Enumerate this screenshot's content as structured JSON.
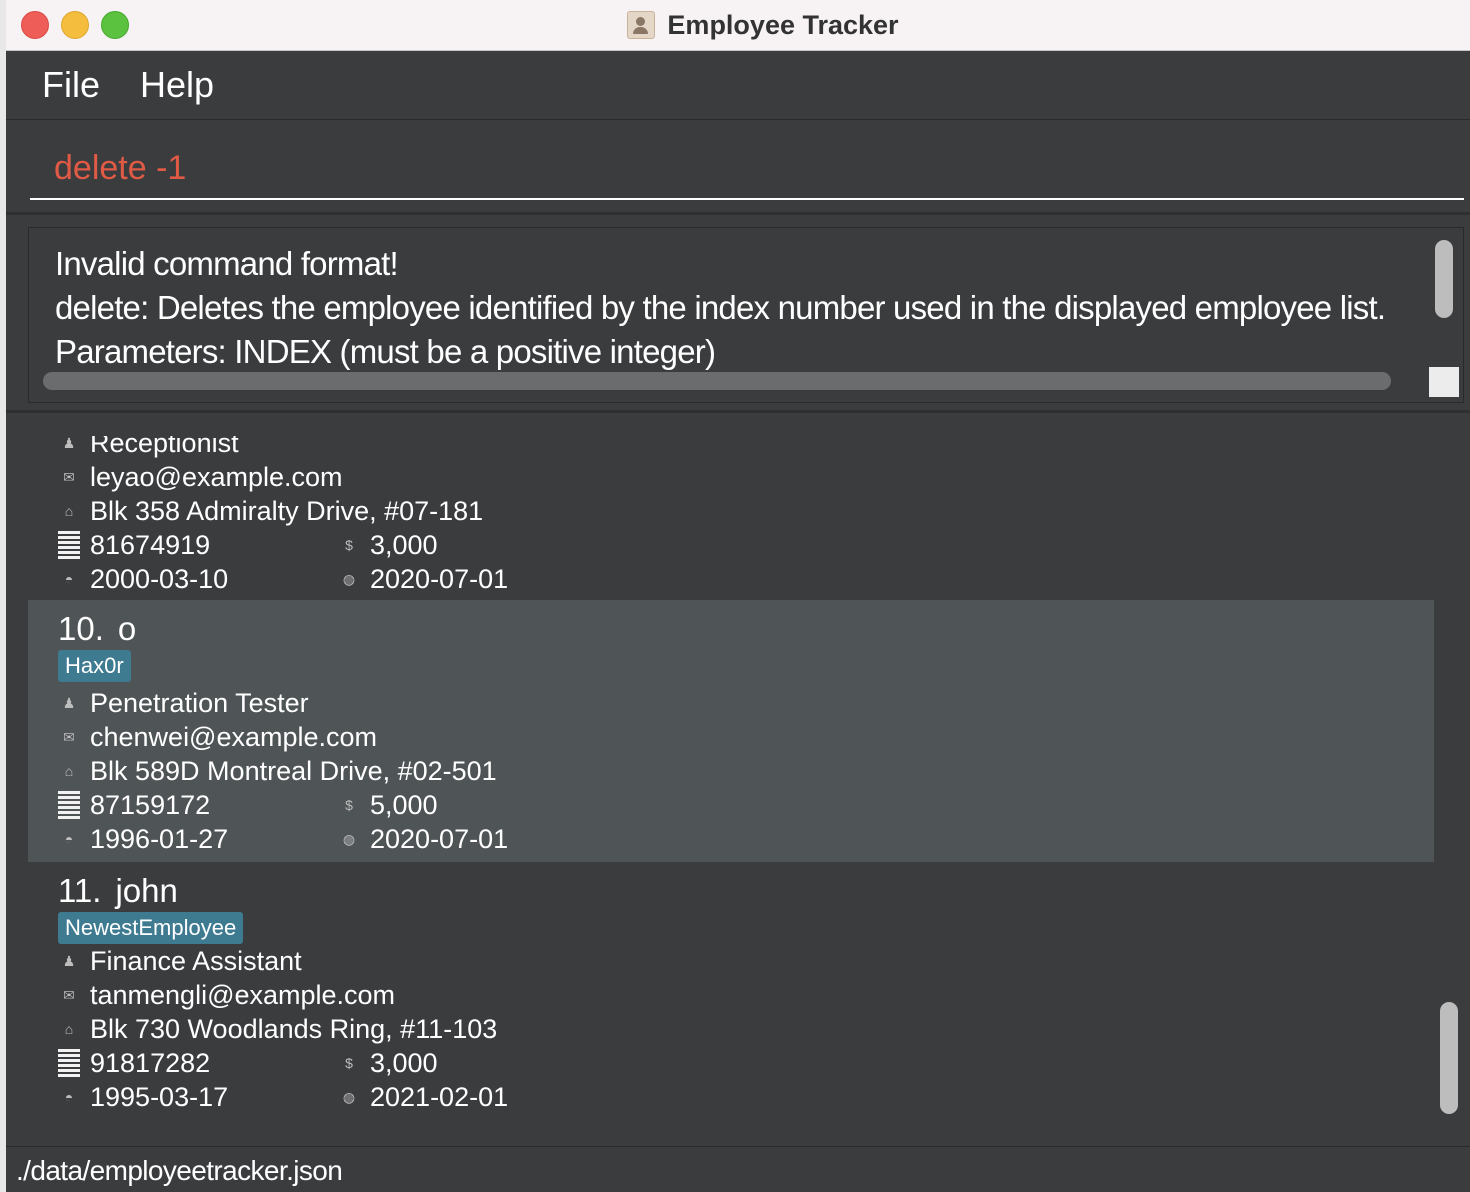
{
  "window": {
    "title": "Employee Tracker"
  },
  "menu": {
    "file": "File",
    "help": "Help"
  },
  "command": {
    "value": "delete -1"
  },
  "result": {
    "lines": [
      "Invalid command format!",
      "delete: Deletes the employee identified by the index number used in the displayed employee list.",
      "Parameters: INDEX (must be a positive integer)"
    ]
  },
  "employees": [
    {
      "index": "",
      "name": "",
      "tag": "",
      "role": "Receptionist",
      "email": "leyao@example.com",
      "address": "Blk 358 Admiralty Drive, #07-181",
      "phone": "81674919",
      "salary": "3,000",
      "birthday": "2000-03-10",
      "join_date": "2020-07-01"
    },
    {
      "index": "10.",
      "name": "o",
      "tag": "Hax0r",
      "role": "Penetration Tester",
      "email": "chenwei@example.com",
      "address": "Blk 589D Montreal Drive, #02-501",
      "phone": "87159172",
      "salary": "5,000",
      "birthday": "1996-01-27",
      "join_date": "2020-07-01"
    },
    {
      "index": "11.",
      "name": "john",
      "tag": "NewestEmployee",
      "role": "Finance Assistant",
      "email": "tanmengli@example.com",
      "address": "Blk 730 Woodlands Ring, #11-103",
      "phone": "91817282",
      "salary": "3,000",
      "birthday": "1995-03-17",
      "join_date": "2021-02-01"
    }
  ],
  "icons": {
    "role": "person-icon",
    "email": "envelope-icon",
    "address": "house-icon",
    "phone": "phone-icon",
    "salary": "dollar-icon",
    "birthday": "cake-icon",
    "join_date": "calendar-icon"
  },
  "status": {
    "file_path": "./data/employeetracker.json"
  },
  "colors": {
    "background": "#3b3c3e",
    "selected_card": "#4f5457",
    "tag": "#3e7b91",
    "command_error": "#e05a45"
  }
}
